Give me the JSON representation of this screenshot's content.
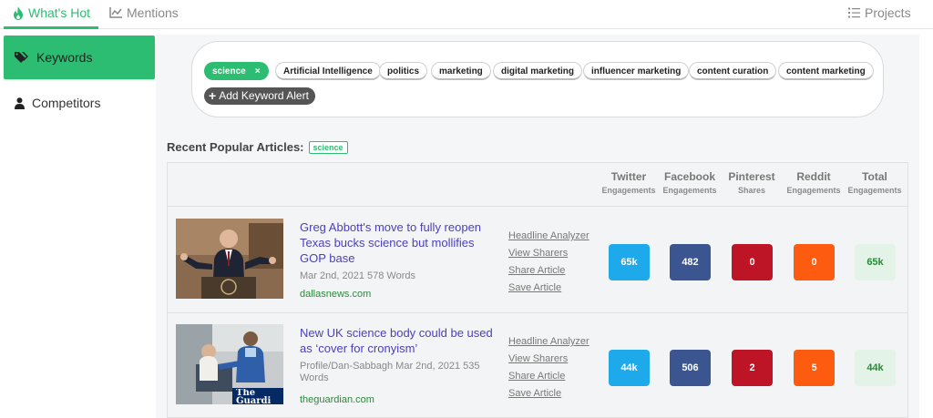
{
  "nav": {
    "whats_hot": "What's Hot",
    "mentions": "Mentions",
    "projects": "Projects"
  },
  "sidebar": {
    "items": [
      {
        "label": "Keywords",
        "icon": "tag-icon",
        "active": true
      },
      {
        "label": "Competitors",
        "icon": "user-icon",
        "active": false
      }
    ]
  },
  "keywords": {
    "chips": [
      {
        "label": "science",
        "active": true
      },
      {
        "label": "Artificial Intelligence"
      },
      {
        "label": "politics"
      },
      {
        "label": "marketing"
      },
      {
        "label": "digital marketing"
      },
      {
        "label": "influencer marketing"
      },
      {
        "label": "content curation"
      },
      {
        "label": "content marketing"
      }
    ],
    "remove_glyph": "×",
    "add_label": "Add Keyword Alert"
  },
  "recent": {
    "heading": "Recent Popular Articles:",
    "tag": "science"
  },
  "columns": [
    {
      "top": "Twitter",
      "bottom": "Engagements"
    },
    {
      "top": "Facebook",
      "bottom": "Engagements"
    },
    {
      "top": "Pinterest",
      "bottom": "Shares"
    },
    {
      "top": "Reddit",
      "bottom": "Engagements"
    },
    {
      "top": "Total",
      "bottom": "Engagements"
    }
  ],
  "row_links": [
    "Headline Analyzer",
    "View Sharers",
    "Share Article",
    "Save Article"
  ],
  "articles": [
    {
      "title": "Greg Abbott's move to fully reopen Texas bucks science but mollifies GOP base",
      "meta": "Mar 2nd, 2021   578 Words",
      "domain": "dallasnews.com",
      "twitter": "65k",
      "facebook": "482",
      "pinterest": "0",
      "reddit": "0",
      "total": "65k"
    },
    {
      "title": "New UK science body could be used as ‘cover for cronyism’",
      "meta": "Profile/Dan-Sabbagh   Mar 2nd, 2021   535 Words",
      "domain": "theguardian.com",
      "thumb_text": "The Guardi",
      "twitter": "44k",
      "facebook": "506",
      "pinterest": "2",
      "reddit": "5",
      "total": "44k"
    }
  ],
  "colors": {
    "accent": "#2dbd72",
    "twitter": "#1ea9ea",
    "facebook": "#3b5590",
    "pinterest": "#bd1525",
    "reddit": "#fc5b10",
    "total_bg": "#e3f3e8",
    "title_link": "#4b3fbd"
  }
}
